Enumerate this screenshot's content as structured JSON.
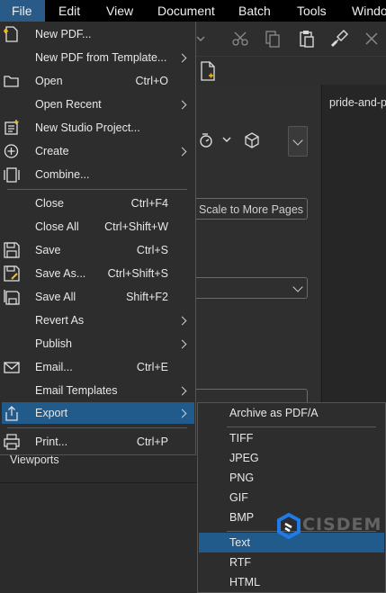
{
  "menubar": {
    "items": [
      "File",
      "Edit",
      "View",
      "Document",
      "Batch",
      "Tools",
      "Windo"
    ]
  },
  "document": {
    "tab_name": "pride-and-pr"
  },
  "panel": {
    "scale_button": "Scale to More Pages",
    "viewports_label": "Viewports"
  },
  "file_menu": {
    "items": [
      {
        "label": "New PDF...",
        "shortcut": "",
        "icon": "new-pdf-icon",
        "submenu": false
      },
      {
        "label": "New PDF from Template...",
        "shortcut": "",
        "icon": "",
        "submenu": true
      },
      {
        "label": "Open",
        "shortcut": "Ctrl+O",
        "icon": "folder-icon",
        "submenu": false
      },
      {
        "label": "Open Recent",
        "shortcut": "",
        "icon": "",
        "submenu": true
      },
      {
        "label": "New Studio Project...",
        "shortcut": "",
        "icon": "studio-project-icon",
        "submenu": false
      },
      {
        "label": "Create",
        "shortcut": "",
        "icon": "plus-circle-icon",
        "submenu": true
      },
      {
        "label": "Combine...",
        "shortcut": "",
        "icon": "combine-icon",
        "submenu": false
      },
      {
        "label": "Close",
        "shortcut": "Ctrl+F4",
        "icon": "",
        "submenu": false
      },
      {
        "label": "Close All",
        "shortcut": "Ctrl+Shift+W",
        "icon": "",
        "submenu": false
      },
      {
        "label": "Save",
        "shortcut": "Ctrl+S",
        "icon": "save-icon",
        "submenu": false
      },
      {
        "label": "Save As...",
        "shortcut": "Ctrl+Shift+S",
        "icon": "save-as-icon",
        "submenu": false
      },
      {
        "label": "Save All",
        "shortcut": "Shift+F2",
        "icon": "save-all-icon",
        "submenu": false
      },
      {
        "label": "Revert As",
        "shortcut": "",
        "icon": "",
        "submenu": true
      },
      {
        "label": "Publish",
        "shortcut": "",
        "icon": "",
        "submenu": true
      },
      {
        "label": "Email...",
        "shortcut": "Ctrl+E",
        "icon": "email-icon",
        "submenu": false
      },
      {
        "label": "Email Templates",
        "shortcut": "",
        "icon": "",
        "submenu": true
      },
      {
        "label": "Export",
        "shortcut": "",
        "icon": "export-icon",
        "submenu": true,
        "highlighted": true
      },
      {
        "label": "Print...",
        "shortcut": "Ctrl+P",
        "icon": "print-icon",
        "submenu": false
      }
    ]
  },
  "export_submenu": {
    "items": [
      {
        "label": "Archive as PDF/A"
      },
      {
        "label": "TIFF"
      },
      {
        "label": "JPEG"
      },
      {
        "label": "PNG"
      },
      {
        "label": "GIF"
      },
      {
        "label": "BMP"
      },
      {
        "label": "Text",
        "highlighted": true
      },
      {
        "label": "RTF"
      },
      {
        "label": "HTML"
      }
    ]
  },
  "watermark": {
    "text": "CISDEM"
  },
  "colors": {
    "menubar_bg": "#000000",
    "menu_bg": "#2d2d2d",
    "highlight": "#215b8c",
    "text": "#e8e8e8",
    "watermark_blue": "#1e7be8"
  }
}
